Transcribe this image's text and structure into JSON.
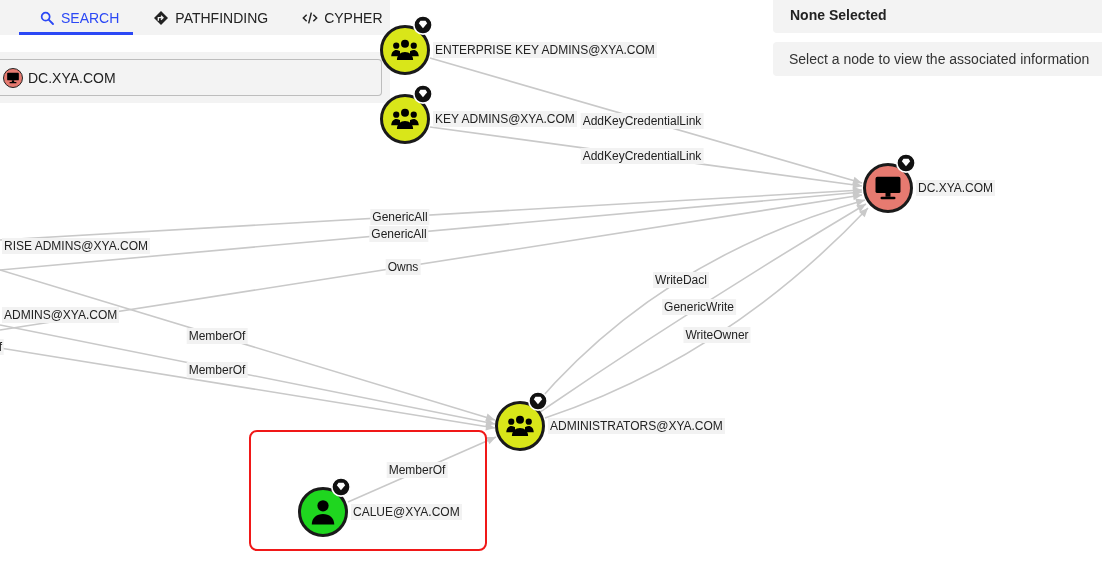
{
  "tabs": [
    {
      "label": "SEARCH",
      "selected": true
    },
    {
      "label": "PATHFINDING",
      "selected": false
    },
    {
      "label": "CYPHER",
      "selected": false
    }
  ],
  "search": {
    "value": "DC.XYA.COM",
    "kind": "computer"
  },
  "info_panel": {
    "title": "None Selected",
    "message": "Select a node to view the associated information"
  },
  "nodes": [
    {
      "kind": "group",
      "label": "ENTERPRISE KEY ADMINS@XYA.COM",
      "color": "#d9e619",
      "high_value": true
    },
    {
      "kind": "group",
      "label": "KEY ADMINS@XYA.COM",
      "color": "#d9e619",
      "high_value": true
    },
    {
      "kind": "computer",
      "label": "DC.XYA.COM",
      "color": "#e67a70",
      "high_value": true
    },
    {
      "label": "RISE ADMINS@XYA.COM"
    },
    {
      "label": "ADMINS@XYA.COM"
    },
    {
      "kind": "group",
      "label": "ADMINISTRATORS@XYA.COM",
      "color": "#d9e619",
      "high_value": true
    },
    {
      "kind": "user",
      "label": "CALUE@XYA.COM",
      "color": "#1fd61f",
      "high_value": true
    }
  ],
  "edges": [
    {
      "label": "AddKeyCredentialLink"
    },
    {
      "label": "AddKeyCredentialLink"
    },
    {
      "label": "GenericAll"
    },
    {
      "label": "GenericAll"
    },
    {
      "label": "Owns"
    },
    {
      "label": "MemberOf"
    },
    {
      "label": "MemberOf"
    },
    {
      "label": "f"
    },
    {
      "label": "WriteDacl"
    },
    {
      "label": "GenericWrite"
    },
    {
      "label": "WriteOwner"
    },
    {
      "label": "MemberOf"
    }
  ],
  "highlight": {
    "kind": "rectangle"
  }
}
